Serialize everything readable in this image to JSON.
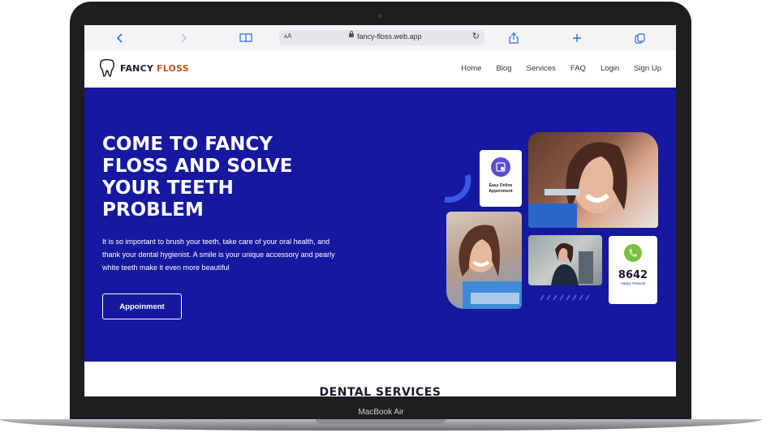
{
  "device": {
    "model_label": "MacBook Air"
  },
  "browser": {
    "text_size_label": "ᴀA",
    "url": "fancy-floss.web.app",
    "icons": [
      "back-icon",
      "forward-icon",
      "book-icon",
      "reload-icon",
      "share-icon",
      "plus-icon",
      "tabs-icon"
    ]
  },
  "site": {
    "logo_part1": "FANCY",
    "logo_part2": "FLOSS",
    "nav": [
      "Home",
      "Blog",
      "Services",
      "FAQ",
      "Login",
      "Sign Up"
    ]
  },
  "hero": {
    "title": "COME TO FANCY FLOSS AND SOLVE YOUR TEETH PROBLEM",
    "description": "It is so important to brush your teeth, take care of your oral health, and thank your dental hygienist. A smile is your unique accessory and pearly white teeth make it even more beautiful",
    "button_label": "Appoinment",
    "card_online": {
      "line1": "Easy Online",
      "line2": "Appoinment"
    },
    "card_stat": {
      "value": "8642",
      "label": "Happy Patients"
    }
  },
  "section": {
    "title": "DENTAL SERVICES"
  },
  "colors": {
    "hero_bg": "#1618a0",
    "accent_orange": "#c0561f",
    "link_blue": "#2f6fe0",
    "stat_icon_green": "#7ac142"
  }
}
